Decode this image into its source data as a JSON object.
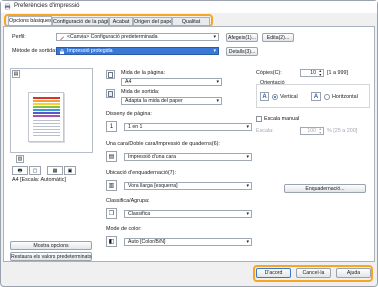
{
  "window": {
    "title": "Preferències d'impressió"
  },
  "tabs": [
    {
      "label": "Opcions bàsiques"
    },
    {
      "label": "Configuració de la pàgina"
    },
    {
      "label": "Acabat"
    },
    {
      "label": "Origen del paper"
    },
    {
      "label": "Qualitat"
    }
  ],
  "profile": {
    "label": "Perfil:",
    "value": "<Canvia> Configuració predeterminada",
    "add_button": "Afegeix(1)...",
    "edit_button": "Edita(2)..."
  },
  "output_method": {
    "label": "Mètode de sortida:",
    "value": "Impressió protegida",
    "details_button": "Detalls(3)..."
  },
  "preview": {
    "caption": "A4 [Escala: Automàtic]"
  },
  "left_buttons": {
    "show_options": "Mostra opcions",
    "restore_defaults": "Restaura els valors predeterminats"
  },
  "page_size": {
    "label": "Mida de la pàgina:",
    "value": "A4"
  },
  "output_size": {
    "label": "Mida de sortida:",
    "value": "Adapta la mida del paper"
  },
  "page_layout": {
    "label": "Disseny de pàgina:",
    "value": "1 en 1",
    "icon_text": "1"
  },
  "duplex": {
    "label": "Una cara/Doble cara/Impressió de quaderns(6):",
    "value": "Impressió d'una cara"
  },
  "binding": {
    "label": "Ubicació d'enquadernació(7):",
    "value": "Vora llarga [esquerra]"
  },
  "collate": {
    "label": "Classifica/Agrupa:",
    "value": "Classifica"
  },
  "color_mode": {
    "label": "Mode de color:",
    "value": "Auto [Color/B/N]"
  },
  "copies": {
    "label": "Còpies(C):",
    "value": "10",
    "range": "[1 a 999]"
  },
  "orientation": {
    "label": "Orientació",
    "portrait_label": "Vertical",
    "landscape_label": "Horitzontal",
    "selected": "Vertical"
  },
  "manual_scaling": {
    "label": "Escala manual",
    "checked": false,
    "scale_label": "Escala:",
    "scale_value": "100",
    "scale_range": "% [25 a 200]"
  },
  "binding_button": "Enquadernació...",
  "footer": {
    "ok": "D'acord",
    "cancel": "Cancel·la",
    "help": "Ajuda"
  },
  "colors": {
    "highlight": "#f6a623",
    "selection_blue": "#3a78d8",
    "icon_red": "#d9342b"
  }
}
